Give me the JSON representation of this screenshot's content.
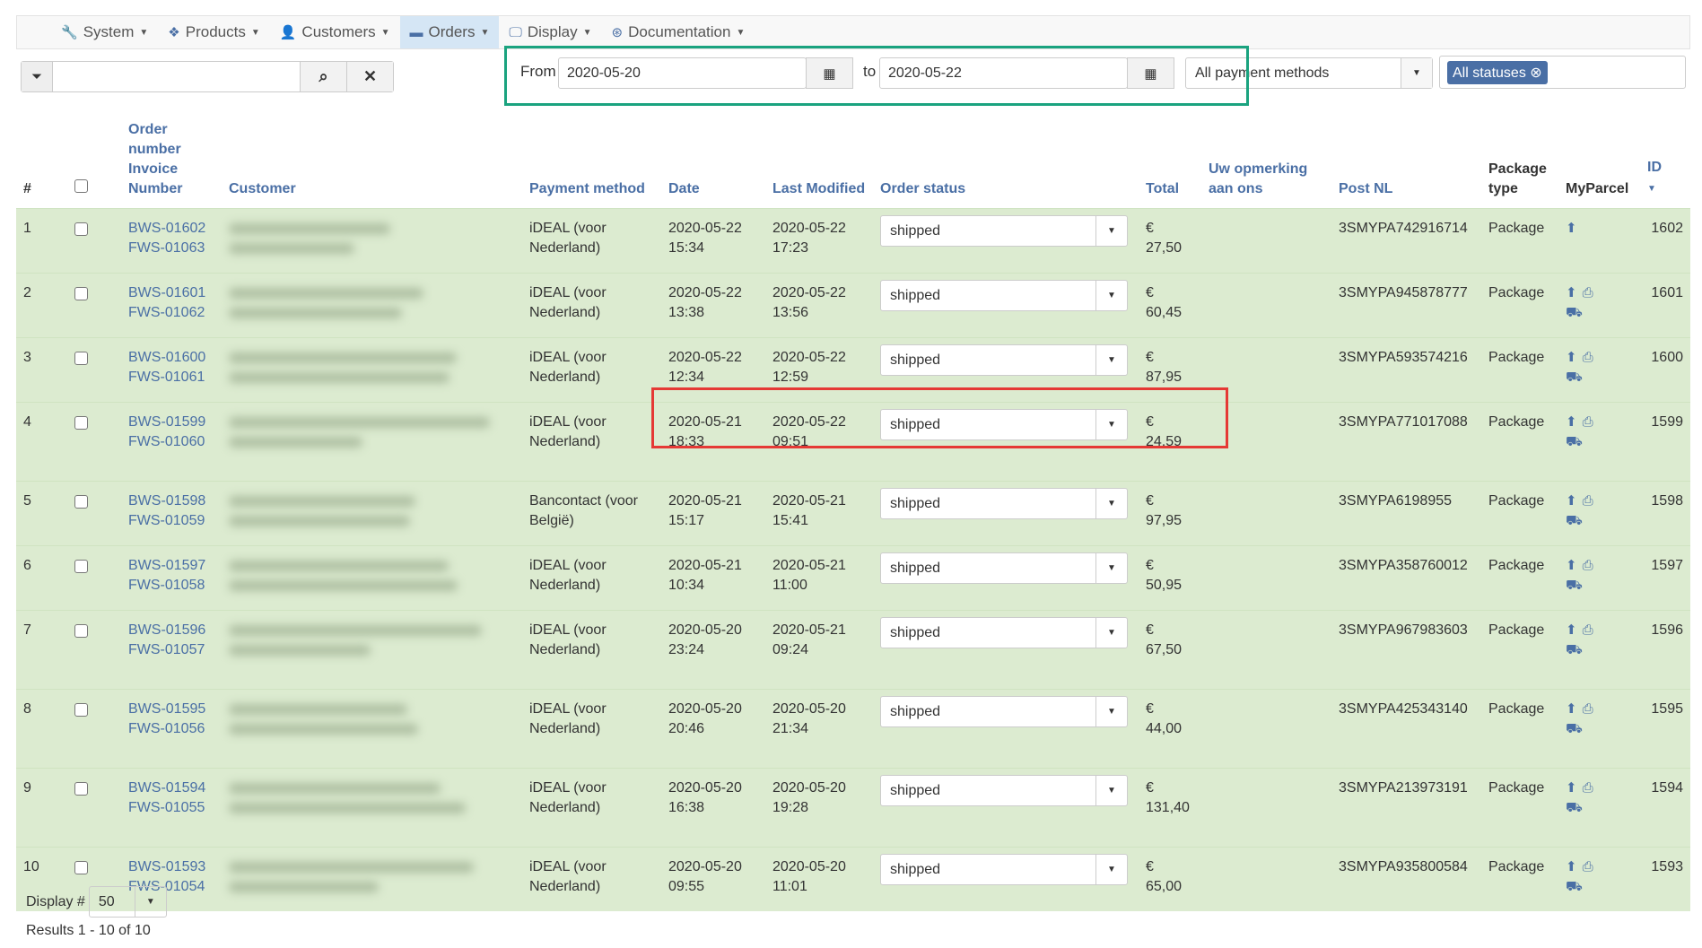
{
  "nav": [
    {
      "label": "System",
      "icon": "wrench-icon",
      "glyph": "🔧"
    },
    {
      "label": "Products",
      "icon": "cubes-icon",
      "glyph": "❖"
    },
    {
      "label": "Customers",
      "icon": "user-icon",
      "glyph": "👤"
    },
    {
      "label": "Orders",
      "icon": "credit-card-icon",
      "glyph": "▬",
      "active": true
    },
    {
      "label": "Display",
      "icon": "monitor-icon",
      "glyph": "🖵"
    },
    {
      "label": "Documentation",
      "icon": "lifebuoy-icon",
      "glyph": "⊛"
    }
  ],
  "filters": {
    "from_label": "From",
    "from_value": "2020-05-20",
    "to_label": "to",
    "to_value": "2020-05-22",
    "payment": "All payment methods",
    "status_badge": "All statuses",
    "search_value": ""
  },
  "headers": {
    "num": "#",
    "order": "Order number Invoice Number",
    "customer": "Customer",
    "payment": "Payment method",
    "date": "Date",
    "modified": "Last Modified",
    "status": "Order status",
    "total": "Total",
    "remark": "Uw opmerking aan ons",
    "postnl": "Post NL",
    "ptype": "Package type",
    "myparcel": "MyParcel",
    "id": "ID"
  },
  "rows": [
    {
      "n": "1",
      "order": "BWS-01602",
      "invoice": "FWS-01063",
      "pay1": "iDEAL (voor",
      "pay2": "Nederland)",
      "d1": "2020-05-22",
      "d2": "15:34",
      "m1": "2020-05-22",
      "m2": "17:23",
      "status": "shipped",
      "total": "27,50",
      "postnl": "3SMYPA742916714",
      "ptype": "Package",
      "id": "1602",
      "icons": "upload"
    },
    {
      "n": "2",
      "order": "BWS-01601",
      "invoice": "FWS-01062",
      "pay1": "iDEAL (voor",
      "pay2": "Nederland)",
      "d1": "2020-05-22",
      "d2": "13:38",
      "m1": "2020-05-22",
      "m2": "13:56",
      "status": "shipped",
      "total": "60,45",
      "postnl": "3SMYPA945878777",
      "ptype": "Package",
      "id": "1601"
    },
    {
      "n": "3",
      "order": "BWS-01600",
      "invoice": "FWS-01061",
      "pay1": "iDEAL (voor",
      "pay2": "Nederland)",
      "d1": "2020-05-22",
      "d2": "12:34",
      "m1": "2020-05-22",
      "m2": "12:59",
      "status": "shipped",
      "total": "87,95",
      "postnl": "3SMYPA593574216",
      "ptype": "Package",
      "id": "1600"
    },
    {
      "n": "4",
      "order": "BWS-01599",
      "invoice": "FWS-01060",
      "pay1": "iDEAL (voor",
      "pay2": "Nederland)",
      "d1": "2020-05-21",
      "d2": "18:33",
      "m1": "2020-05-22",
      "m2": "09:51",
      "status": "shipped",
      "total": "24,59",
      "postnl": "3SMYPA771017088",
      "ptype": "Package",
      "id": "1599",
      "tall": true
    },
    {
      "n": "5",
      "order": "BWS-01598",
      "invoice": "FWS-01059",
      "pay1": "Bancontact (voor",
      "pay2": "België)",
      "d1": "2020-05-21",
      "d2": "15:17",
      "m1": "2020-05-21",
      "m2": "15:41",
      "status": "shipped",
      "total": "97,95",
      "postnl": "3SMYPA6198955",
      "ptype": "Package",
      "id": "1598"
    },
    {
      "n": "6",
      "order": "BWS-01597",
      "invoice": "FWS-01058",
      "pay1": "iDEAL (voor",
      "pay2": "Nederland)",
      "d1": "2020-05-21",
      "d2": "10:34",
      "m1": "2020-05-21",
      "m2": "11:00",
      "status": "shipped",
      "total": "50,95",
      "postnl": "3SMYPA358760012",
      "ptype": "Package",
      "id": "1597"
    },
    {
      "n": "7",
      "order": "BWS-01596",
      "invoice": "FWS-01057",
      "pay1": "iDEAL (voor",
      "pay2": "Nederland)",
      "d1": "2020-05-20",
      "d2": "23:24",
      "m1": "2020-05-21",
      "m2": "09:24",
      "status": "shipped",
      "total": "67,50",
      "postnl": "3SMYPA967983603",
      "ptype": "Package",
      "id": "1596",
      "tall": true
    },
    {
      "n": "8",
      "order": "BWS-01595",
      "invoice": "FWS-01056",
      "pay1": "iDEAL (voor",
      "pay2": "Nederland)",
      "d1": "2020-05-20",
      "d2": "20:46",
      "m1": "2020-05-20",
      "m2": "21:34",
      "status": "shipped",
      "total": "44,00",
      "postnl": "3SMYPA425343140",
      "ptype": "Package",
      "id": "1595",
      "tall": true
    },
    {
      "n": "9",
      "order": "BWS-01594",
      "invoice": "FWS-01055",
      "pay1": "iDEAL (voor",
      "pay2": "Nederland)",
      "d1": "2020-05-20",
      "d2": "16:38",
      "m1": "2020-05-20",
      "m2": "19:28",
      "status": "shipped",
      "total": "131,40",
      "postnl": "3SMYPA213973191",
      "ptype": "Package",
      "id": "1594",
      "tall": true
    },
    {
      "n": "10",
      "order": "BWS-01593",
      "invoice": "FWS-01054",
      "pay1": "iDEAL (voor",
      "pay2": "Nederland)",
      "d1": "2020-05-20",
      "d2": "09:55",
      "m1": "2020-05-20",
      "m2": "11:01",
      "status": "shipped",
      "total": "65,00",
      "postnl": "3SMYPA935800584",
      "ptype": "Package",
      "id": "1593"
    }
  ],
  "currency": "€",
  "footer": {
    "display_label": "Display #",
    "display_value": "50",
    "results": "Results 1 - 10 of 10"
  },
  "colors": {
    "accent": "#4a6fa5",
    "row_bg": "#dcebd0",
    "green_box": "#1aa37f",
    "red_box": "#e53935"
  }
}
